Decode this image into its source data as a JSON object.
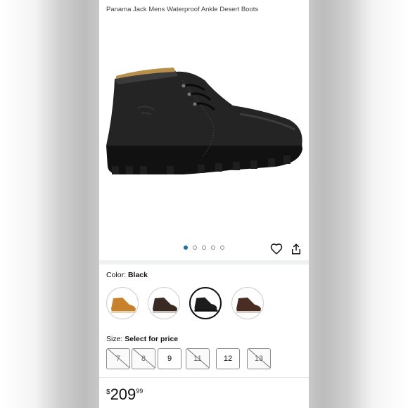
{
  "product": {
    "title": "Panama Jack Mens Waterproof Ankle Desert Boots"
  },
  "gallery": {
    "image_count": 5,
    "active_index": 0,
    "colors": {
      "dot_active": "#1f6fa8",
      "dot_inactive": "#888888"
    }
  },
  "actions": {
    "favorite_icon": "heart-icon",
    "share_icon": "share-icon"
  },
  "color": {
    "label": "Color: ",
    "selected": "Black",
    "options": [
      {
        "name": "tan-swatch",
        "hex": "#c8822e"
      },
      {
        "name": "dark-brown-swatch",
        "hex": "#3a2a24"
      },
      {
        "name": "black-swatch",
        "hex": "#1c1c1c"
      },
      {
        "name": "brown-swatch",
        "hex": "#4a2d22"
      }
    ],
    "selected_index": 2
  },
  "size": {
    "label": "Size: ",
    "prompt": "Select for price",
    "options": [
      {
        "label": "7",
        "available": false
      },
      {
        "label": "8",
        "available": false
      },
      {
        "label": "9",
        "available": true
      },
      {
        "label": "11",
        "available": false
      },
      {
        "label": "12",
        "available": true
      },
      {
        "label": "13",
        "available": false
      }
    ]
  },
  "price": {
    "currency": "$",
    "whole": "209",
    "fraction": "99"
  }
}
